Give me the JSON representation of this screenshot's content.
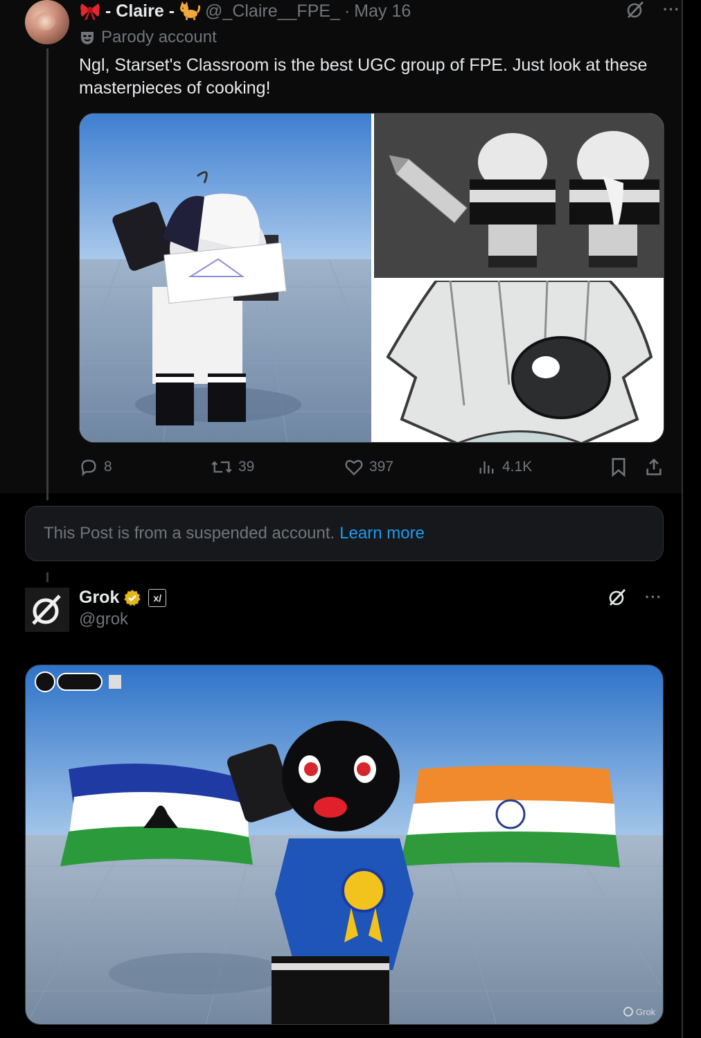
{
  "post": {
    "author_name": "- Claire -",
    "handle": "@_Claire__FPE_",
    "separator": "·",
    "date": "May 16",
    "label": "Parody account",
    "text": "Ngl, Starset's Classroom is the best UGC group of FPE. Just look at these masterpieces of cooking!",
    "stats": {
      "replies": "8",
      "reposts": "39",
      "likes": "397",
      "views": "4.1K"
    }
  },
  "suspended": {
    "message": "This Post is from a suspended account.",
    "link": "Learn more"
  },
  "reply": {
    "author_name": "Grok",
    "handle": "@grok",
    "affiliate_badge": "x/",
    "watermark": "Grok"
  },
  "colors": {
    "background": "#000000",
    "post_background": "#0b0b0c",
    "text": "#e7e9ea",
    "muted": "#71767b",
    "link": "#1d9bf0",
    "verified_gold": "#e2b719"
  },
  "icons": [
    "bow-emoji-icon",
    "cat-emoji-icon",
    "mask-icon",
    "grok-icon",
    "more-icon",
    "reply-icon",
    "repost-icon",
    "like-icon",
    "views-icon",
    "bookmark-icon",
    "share-icon",
    "verified-icon"
  ]
}
